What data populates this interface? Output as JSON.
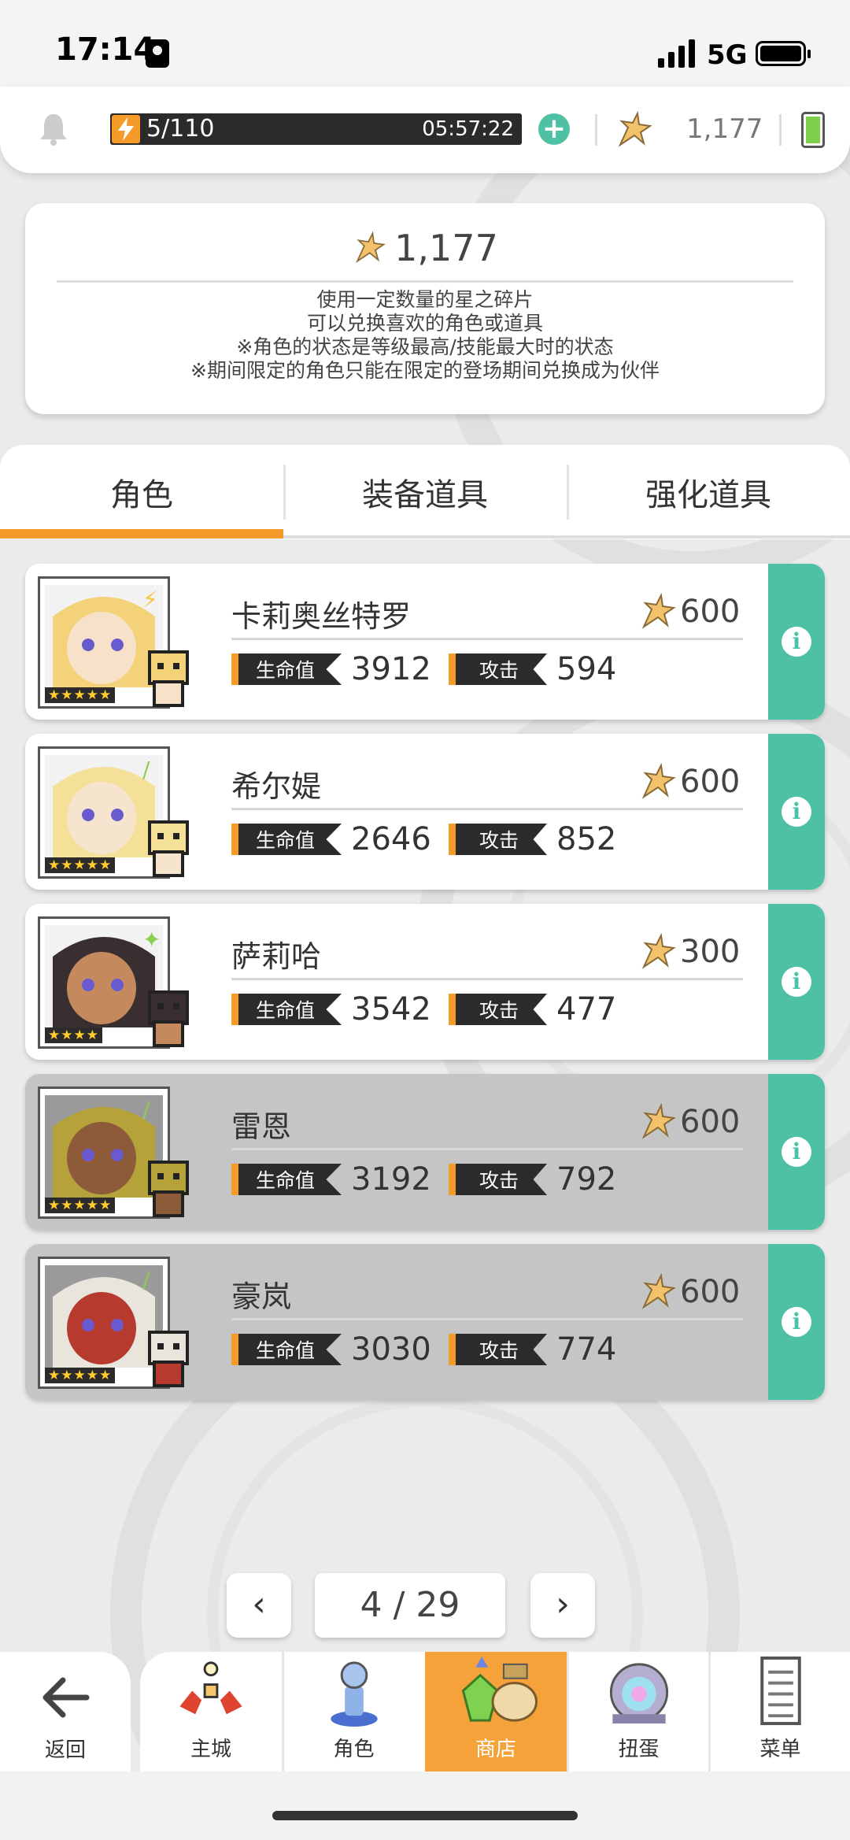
{
  "status_bar": {
    "time": "17:14",
    "network": "5G"
  },
  "top_bar": {
    "stamina": "5/110",
    "stamina_timer": "05:57:22",
    "star_fragments": "1,177"
  },
  "info_panel": {
    "amount": "1,177",
    "lines": [
      "使用一定数量的星之碎片",
      "可以兑换喜欢的角色或道具",
      "※角色的状态是等级最高/技能最大时的状态",
      "※期间限定的角色只能在限定的登场期间兑换成为伙伴"
    ]
  },
  "tabs": [
    "角色",
    "装备道具",
    "强化道具"
  ],
  "active_tab": "角色",
  "stat_labels": {
    "hp": "生命值",
    "atk": "攻击"
  },
  "characters": [
    {
      "name": "卡莉奥丝特罗",
      "cost": "600",
      "hp": "3912",
      "atk": "594",
      "stars": "★★★★★",
      "element": "⚡",
      "available": true
    },
    {
      "name": "希尔媞",
      "cost": "600",
      "hp": "2646",
      "atk": "852",
      "stars": "★★★★★",
      "element": "/",
      "available": true
    },
    {
      "name": "萨莉哈",
      "cost": "300",
      "hp": "3542",
      "atk": "477",
      "stars": "★★★★",
      "element": "✦",
      "available": true
    },
    {
      "name": "雷恩",
      "cost": "600",
      "hp": "3192",
      "atk": "792",
      "stars": "★★★★★",
      "element": "/",
      "available": false
    },
    {
      "name": "豪岚",
      "cost": "600",
      "hp": "3030",
      "atk": "774",
      "stars": "★★★★★",
      "element": "/",
      "available": false
    }
  ],
  "pagination": {
    "prev": "‹",
    "next": "›",
    "label": "4 / 29"
  },
  "bottom_nav": {
    "back": "返回",
    "items": [
      "主城",
      "角色",
      "商店",
      "扭蛋",
      "菜单"
    ],
    "active": "商店"
  },
  "colors": {
    "accent": "#f59b2a",
    "teal": "#4ec1a5",
    "dark": "#2b2b2b"
  }
}
